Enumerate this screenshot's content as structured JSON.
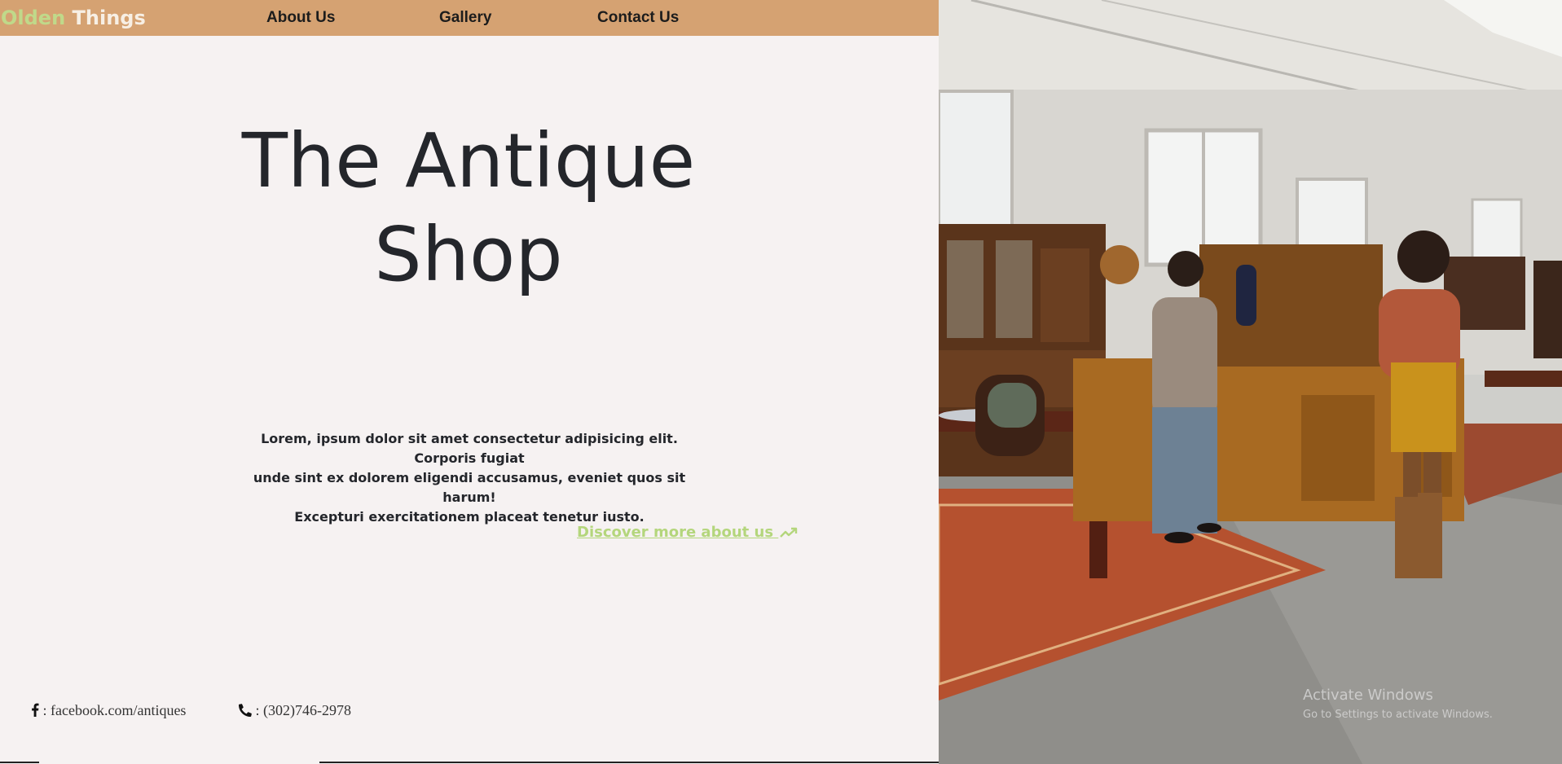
{
  "brand": {
    "part1": "Olden",
    "part2": "Things"
  },
  "nav": {
    "about": "About Us",
    "gallery": "Gallery",
    "contact": "Contact Us"
  },
  "hero": {
    "title_line1": "The Antique",
    "title_line2": "Shop",
    "text_line1": "Lorem, ipsum dolor sit amet consectetur adipisicing elit. Corporis fugiat",
    "text_line2": "unde sint ex dolorem eligendi accusamus, eveniet quos sit harum!",
    "text_line3": "Excepturi exercitationem placeat tenetur iusto.",
    "cta": "Discover more about us"
  },
  "footer": {
    "facebook": ": facebook.com/antiques",
    "phone": ": (302)746-2978"
  },
  "watermark": {
    "title": "Activate Windows",
    "subtitle": "Go to Settings to activate Windows."
  },
  "icons": {
    "facebook": "facebook-icon",
    "phone": "phone-icon",
    "arrow": "trending-up-arrow-icon"
  },
  "colors": {
    "navbar": "#d5a272",
    "brand_accent": "#c0d98a",
    "cta": "#b4d67c",
    "background": "#f6f2f2",
    "text": "#24262b"
  }
}
